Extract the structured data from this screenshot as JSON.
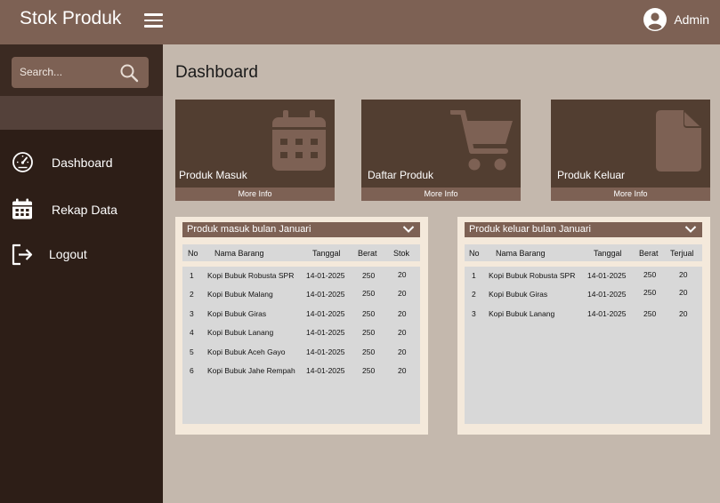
{
  "header": {
    "title": "Stok Produk",
    "user_name": "Admin"
  },
  "sidebar": {
    "search_placeholder": "Search...",
    "items": [
      {
        "label": "Dashboard",
        "icon": "speedometer-icon"
      },
      {
        "label": "Rekap Data",
        "icon": "calendar-icon"
      },
      {
        "label": "Logout",
        "icon": "logout-icon"
      }
    ]
  },
  "main": {
    "title": "Dashboard",
    "cards": [
      {
        "label": "Produk Masuk",
        "more": "More Info",
        "icon": "calendar-icon"
      },
      {
        "label": "Daftar Produk",
        "more": "More Info",
        "icon": "cart-icon"
      },
      {
        "label": "Produk Keluar",
        "more": "More Info",
        "icon": "document-icon"
      }
    ],
    "panel_in": {
      "title": "Produk masuk bulan Januari",
      "columns": [
        "No",
        "Nama Barang",
        "Tanggal",
        "Berat",
        "Stok"
      ],
      "rows": [
        [
          "1",
          "Kopi Bubuk Robusta SPR",
          "14-01-2025",
          "250",
          "20"
        ],
        [
          "2",
          "Kopi Bubuk Malang",
          "14-01-2025",
          "250",
          "20"
        ],
        [
          "3",
          "Kopi Bubuk Giras",
          "14-01-2025",
          "250",
          "20"
        ],
        [
          "4",
          "Kopi Bubuk Lanang",
          "14-01-2025",
          "250",
          "20"
        ],
        [
          "5",
          "Kopi Bubuk Aceh Gayo",
          "14-01-2025",
          "250",
          "20"
        ],
        [
          "6",
          "Kopi Bubuk Jahe Rempah",
          "14-01-2025",
          "250",
          "20"
        ]
      ]
    },
    "panel_out": {
      "title": "Produk keluar bulan Januari",
      "columns": [
        "No",
        "Nama Barang",
        "Tanggal",
        "Berat",
        "Terjual"
      ],
      "rows": [
        [
          "1",
          "Kopi Bubuk Robusta SPR",
          "14-01-2025",
          "250",
          "20"
        ],
        [
          "2",
          "Kopi Bubuk Giras",
          "14-01-2025",
          "250",
          "20"
        ],
        [
          "3",
          "Kopi Bubuk Lanang",
          "14-01-2025",
          "250",
          "20"
        ]
      ]
    }
  },
  "colors": {
    "topbar": "#7d6154",
    "sidebar": "#2d1e17",
    "card": "#523e31",
    "content_bg": "#c4b8ad",
    "panel_bg": "#f4e9db"
  }
}
